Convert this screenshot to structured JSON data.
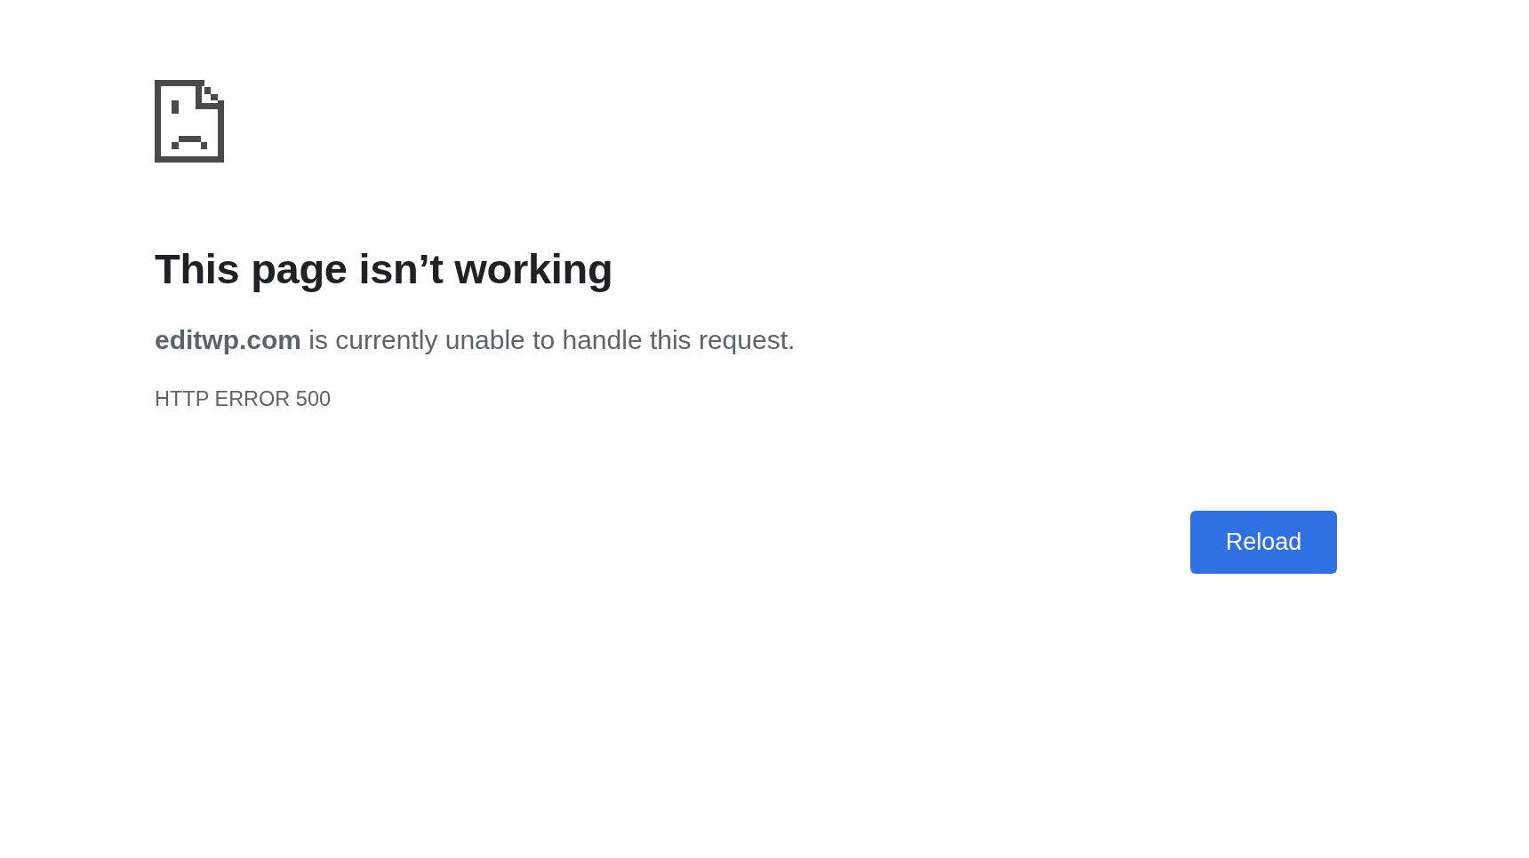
{
  "error": {
    "title": "This page isn’t working",
    "message": "**editwp.com** is currently unable to handle this request.",
    "code": "HTTP ERROR 500"
  },
  "buttons": [
    {
      "label": "Reload",
      "kind": "primary"
    }
  ]
}
